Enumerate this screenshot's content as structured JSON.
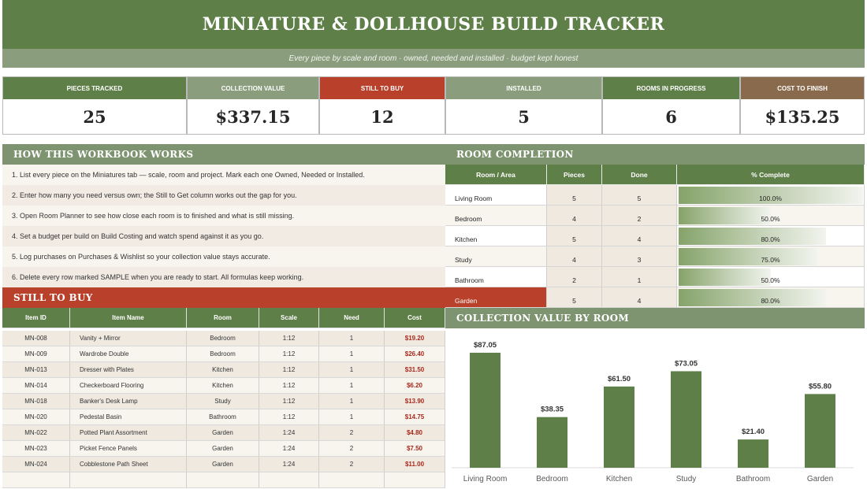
{
  "header": {
    "title": "MINIATURE & DOLLHOUSE BUILD TRACKER",
    "subtitle": "Every piece by scale and room · owned, needed and installed · budget kept honest"
  },
  "kpis": [
    {
      "label": "PIECES TRACKED",
      "value": "25",
      "color": "#5f7f49"
    },
    {
      "label": "COLLECTION VALUE",
      "value": "$337.15",
      "color": "#8a9e7d"
    },
    {
      "label": "STILL TO BUY",
      "value": "12",
      "color": "#b9402a"
    },
    {
      "label": "INSTALLED",
      "value": "5",
      "color": "#8a9e7d"
    },
    {
      "label": "ROOMS IN PROGRESS",
      "value": "6",
      "color": "#5f7f49"
    },
    {
      "label": "COST TO FINISH",
      "value": "$135.25",
      "color": "#8a6a4d"
    }
  ],
  "how": {
    "title": "HOW THIS WORKBOOK WORKS",
    "steps": [
      "1.  List every piece on the Miniatures tab — scale, room and project. Mark each one Owned, Needed or Installed.",
      "2.  Enter how many you need versus own; the Still to Get column works out the gap for you.",
      "3.  Open Room Planner to see how close each room is to finished and what is still missing.",
      "4.  Set a budget per build on Build Costing and watch spend against it as you go.",
      "5.  Log purchases on Purchases & Wishlist so your collection value stays accurate.",
      "6.  Delete every row marked SAMPLE when you are ready to start. All formulas keep working."
    ]
  },
  "room_completion": {
    "title": "ROOM COMPLETION",
    "headers": [
      "Room / Area",
      "Pieces",
      "Done",
      "% Complete"
    ],
    "rows": [
      {
        "room": "Living Room",
        "pieces": "5",
        "done": "5",
        "pct_label": "100.0%",
        "pct": 1.0
      },
      {
        "room": "Bedroom",
        "pieces": "4",
        "done": "2",
        "pct_label": "50.0%",
        "pct": 0.5
      },
      {
        "room": "Kitchen",
        "pieces": "5",
        "done": "4",
        "pct_label": "80.0%",
        "pct": 0.8
      },
      {
        "room": "Study",
        "pieces": "4",
        "done": "3",
        "pct_label": "75.0%",
        "pct": 0.75
      },
      {
        "room": "Bathroom",
        "pieces": "2",
        "done": "1",
        "pct_label": "50.0%",
        "pct": 0.5
      },
      {
        "room": "Garden",
        "pieces": "5",
        "done": "4",
        "pct_label": "80.0%",
        "pct": 0.8
      }
    ]
  },
  "still_to_buy": {
    "title": "STILL TO BUY",
    "headers": [
      "Item ID",
      "Item Name",
      "Room",
      "Scale",
      "Need",
      "Cost"
    ],
    "rows": [
      [
        "MN-008",
        "Vanity + Mirror",
        "Bedroom",
        "1:12",
        "1",
        "$19.20"
      ],
      [
        "MN-009",
        "Wardrobe Double",
        "Bedroom",
        "1:12",
        "1",
        "$26.40"
      ],
      [
        "MN-013",
        "Dresser with Plates",
        "Kitchen",
        "1:12",
        "1",
        "$31.50"
      ],
      [
        "MN-014",
        "Checkerboard Flooring",
        "Kitchen",
        "1:12",
        "1",
        "$6.20"
      ],
      [
        "MN-018",
        "Banker's Desk Lamp",
        "Study",
        "1:12",
        "1",
        "$13.90"
      ],
      [
        "MN-020",
        "Pedestal Basin",
        "Bathroom",
        "1:12",
        "1",
        "$14.75"
      ],
      [
        "MN-022",
        "Potted Plant Assortment",
        "Garden",
        "1:24",
        "2",
        "$4.80"
      ],
      [
        "MN-023",
        "Picket Fence Panels",
        "Garden",
        "1:24",
        "2",
        "$7.50"
      ],
      [
        "MN-024",
        "Cobblestone Path Sheet",
        "Garden",
        "1:24",
        "2",
        "$11.00"
      ],
      [
        "",
        "",
        "",
        "",
        "",
        ""
      ]
    ]
  },
  "collection_chart": {
    "title": "COLLECTION VALUE BY ROOM"
  },
  "chart_data": {
    "type": "bar",
    "categories": [
      "Living Room",
      "Bedroom",
      "Kitchen",
      "Study",
      "Bathroom",
      "Garden"
    ],
    "values": [
      87.05,
      38.35,
      61.5,
      73.05,
      21.4,
      55.8
    ],
    "value_labels": [
      "$87.05",
      "$38.35",
      "$61.50",
      "$73.05",
      "$21.40",
      "$55.80"
    ],
    "title": "",
    "xlabel": "",
    "ylabel": "",
    "ylim": [
      0,
      90
    ],
    "grid": false,
    "bar_color": "#5f7f49"
  },
  "colors": {
    "green": "#5f7f49",
    "sage": "#8a9e7d",
    "red": "#b9402a",
    "brown": "#8a6a4d",
    "cream": "#f7f5ee",
    "beige": "#efe9e0",
    "cost": "#a82a1c"
  }
}
